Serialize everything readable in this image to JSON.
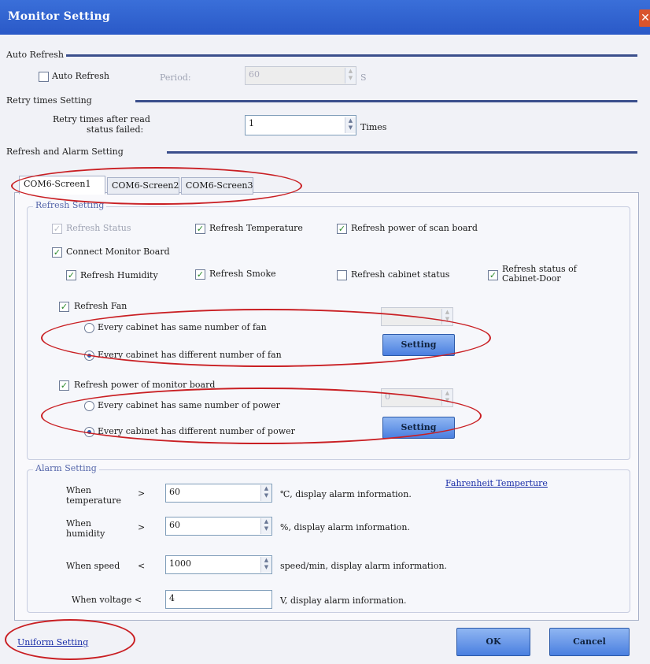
{
  "window": {
    "title": "Monitor Setting"
  },
  "auto_refresh": {
    "section_label": "Auto Refresh",
    "checkbox_label": "Auto Refresh",
    "checked": false,
    "period_label": "Period:",
    "period_value": "60",
    "period_unit": "S"
  },
  "retry": {
    "section_label": "Retry times Setting",
    "label_line1": "Retry times after read",
    "label_line2": "status failed:",
    "value": "1",
    "unit": "Times"
  },
  "refresh_alarm": {
    "section_label": "Refresh and Alarm Setting"
  },
  "tabs": [
    {
      "label": "COM6-Screen1",
      "active": true
    },
    {
      "label": "COM6-Screen2",
      "active": false
    },
    {
      "label": "COM6-Screen3",
      "active": false
    }
  ],
  "refresh_setting": {
    "group_label": "Refresh Setting",
    "refresh_status": "Refresh Status",
    "refresh_temperature": "Refresh Temperature",
    "refresh_power_scan": "Refresh power of scan board",
    "connect_monitor": "Connect Monitor Board",
    "refresh_humidity": "Refresh Humidity",
    "refresh_smoke": "Refresh Smoke",
    "refresh_cabinet_status": "Refresh cabinet status",
    "refresh_door_line1": "Refresh status of",
    "refresh_door_line2": "Cabinet-Door",
    "refresh_fan": "Refresh Fan",
    "fan_same": "Every cabinet has same number of fan",
    "fan_different": "Every cabinet has different number of fan",
    "fan_setting_button": "Setting",
    "refresh_power_monitor": "Refresh power of monitor board",
    "power_same": "Every cabinet has same number of power",
    "power_different": "Every cabinet has different number of power",
    "power_setting_button": "Setting",
    "power_count_value": "0"
  },
  "alarm_setting": {
    "group_label": "Alarm Setting",
    "fahrenheit_link": "Fahrenheit Temperture",
    "temp_label_line1": "When",
    "temp_label_line2": "temperature",
    "temp_op": ">",
    "temp_value": "60",
    "temp_unit": "℃, display alarm information.",
    "hum_label_line1": "When",
    "hum_label_line2": "humidity",
    "hum_op": ">",
    "hum_value": "60",
    "hum_unit": "%, display alarm information.",
    "speed_label": "When speed",
    "speed_op": "<",
    "speed_value": "1000",
    "speed_unit": "speed/min, display alarm information.",
    "voltage_label": "When voltage <",
    "voltage_value": "4",
    "voltage_unit": "V, display alarm information."
  },
  "footer": {
    "uniform_link": "Uniform Setting",
    "ok_button": "OK",
    "cancel_button": "Cancel"
  },
  "annotation_color": "#c91f23",
  "accent_color": "#3b4f8c"
}
